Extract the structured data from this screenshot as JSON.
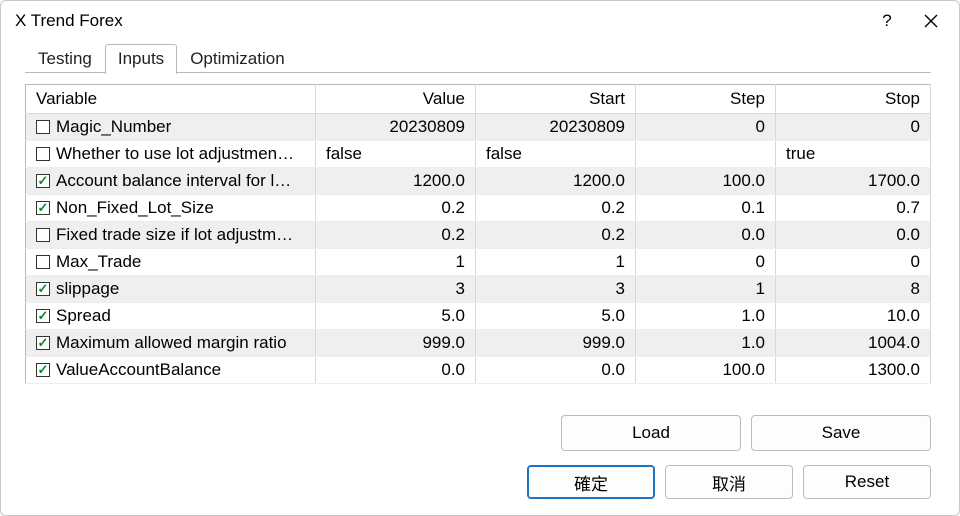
{
  "window": {
    "title": "X Trend Forex"
  },
  "tabs": {
    "testing": "Testing",
    "inputs": "Inputs",
    "optimization": "Optimization",
    "active": "inputs"
  },
  "headers": {
    "variable": "Variable",
    "value": "Value",
    "start": "Start",
    "step": "Step",
    "stop": "Stop"
  },
  "rows": [
    {
      "checked": false,
      "name": "Magic_Number",
      "value": "20230809",
      "start": "20230809",
      "step": "0",
      "stop": "0"
    },
    {
      "checked": false,
      "name": "Whether to use lot adjustment ...",
      "value": "false",
      "start": "false",
      "step": "",
      "stop": "true",
      "text": true
    },
    {
      "checked": true,
      "name": "Account balance interval for lot ...",
      "value": "1200.0",
      "start": "1200.0",
      "step": "100.0",
      "stop": "1700.0"
    },
    {
      "checked": true,
      "name": "Non_Fixed_Lot_Size",
      "value": "0.2",
      "start": "0.2",
      "step": "0.1",
      "stop": "0.7"
    },
    {
      "checked": false,
      "name": "Fixed trade size if lot adjustmen...",
      "value": "0.2",
      "start": "0.2",
      "step": "0.0",
      "stop": "0.0"
    },
    {
      "checked": false,
      "name": "Max_Trade",
      "value": "1",
      "start": "1",
      "step": "0",
      "stop": "0"
    },
    {
      "checked": true,
      "name": "slippage",
      "value": "3",
      "start": "3",
      "step": "1",
      "stop": "8"
    },
    {
      "checked": true,
      "name": "Spread",
      "value": "5.0",
      "start": "5.0",
      "step": "1.0",
      "stop": "10.0"
    },
    {
      "checked": true,
      "name": "Maximum allowed margin ratio",
      "value": "999.0",
      "start": "999.0",
      "step": "1.0",
      "stop": "1004.0"
    },
    {
      "checked": true,
      "name": "ValueAccountBalance",
      "value": "0.0",
      "start": "0.0",
      "step": "100.0",
      "stop": "1300.0"
    }
  ],
  "buttons": {
    "load": "Load",
    "save": "Save",
    "ok": "確定",
    "cancel": "取消",
    "reset": "Reset"
  }
}
